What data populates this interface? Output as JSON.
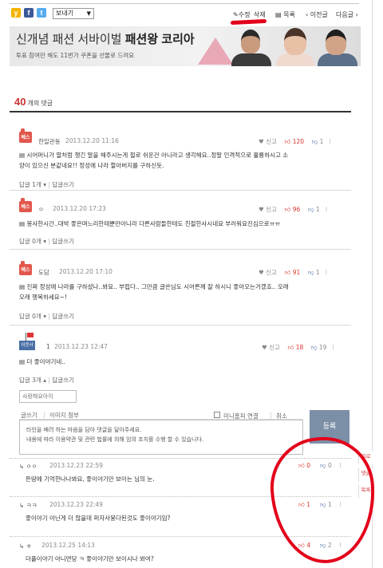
{
  "toolbar": {
    "share_select": "보내기",
    "edit": "수정",
    "delete": "삭제",
    "list": "목록",
    "prev": "이전글",
    "next": "다음글"
  },
  "banner": {
    "title_part1": "신개념 패션 서바이벌 ",
    "title_part2": "패션왕 코리아",
    "subtitle": "투표 참여만 해도 11번가 쿠폰을 선물로 드려요"
  },
  "comments_header": {
    "count": "40",
    "unit": "개의 댓글"
  },
  "comments": [
    {
      "badge": "베스",
      "nickname": "한일관동",
      "date": "2013.12.20 11:16",
      "flag": "신고",
      "up": "120",
      "down": "1",
      "text_line1": "시어머니가 딸처럼 챙긴 말을 해주시는게 절로 쉬운건 아니라고 생각해요..정말 인격적으로 훌륭하시고 소",
      "text_line2": "양이 있으신 분같네요!! 정성에 나라 할아버지를 구하신듯.",
      "replies": "답글 1개",
      "write": "답글쓰기"
    },
    {
      "badge": "베스",
      "nickname": "ㅇ",
      "date": "2013.12.20 17:23",
      "flag": "신고",
      "up": "96",
      "down": "1",
      "text_line1": "봉사한시간..대박 좋은며느리한테뿐만아니라 다른사람들한테도 친절한사시네요 부러워요진심으로ㅠㅠ",
      "replies": "답글 0개",
      "write": "답글쓰기"
    },
    {
      "badge": "베스",
      "nickname": "도담",
      "date": "2013.12.20 17:10",
      "flag": "신고",
      "up": "91",
      "down": "1",
      "text_line1": "진짜 정성에 나라를 구하셨나..봐요.. 부럽다.. 그만큼 글쓴님도 시어른께 잘 하시니 좋아오는거겠죠.. 오래",
      "text_line2": "오래 행복하세요~!",
      "replies": "답글 0개",
      "write": "답글쓰기"
    },
    {
      "badge": "이웃사람",
      "nickname": "1",
      "date": "2013.12.23 12:47",
      "flag": "신고",
      "up": "18",
      "down": "19",
      "text_line1": "더 좋이야기네..",
      "replies": "답글 3개",
      "write": "답글쓰기"
    }
  ],
  "reply_form": {
    "name_value": "사랑해요아이",
    "tab_text": "글쓰기",
    "tab_image": "이미지 첨부",
    "check_mini": "미니홈피 연결",
    "check_cancel": "취소",
    "placeholder_line1": "타인을 배려 하는 마음을 담아 댓글을 달아주세요.",
    "placeholder_line2": "내용에 따라 이용약관 및 관련 법률에 의해 임의 조치를 수행 할 수 있습니다.",
    "submit": "등록"
  },
  "replies": [
    {
      "nickname": "ㅇㅇ",
      "date": "2013.12.23 22:59",
      "text": "뜬땅에 기억한나나봐요, 좋이야기만 보이는 님의 눈.",
      "up": "0",
      "down": "0"
    },
    {
      "nickname": "ㅋㅋ",
      "date": "2013.12.23 22:49",
      "text": "좋이야기 아닌게 더 많을데 퍼자사뭉다된것도 좋이야기임?",
      "up": "1",
      "down": "1"
    },
    {
      "nickname": "ㅎ",
      "date": "2013.12.25 14:13",
      "text": "더플이야기 아니면당 ㅋ 좋이야기만 보이시나 봐여?",
      "up": "4",
      "down": "2"
    }
  ],
  "side_tabs": [
    "위로",
    "댓글",
    "목록"
  ]
}
